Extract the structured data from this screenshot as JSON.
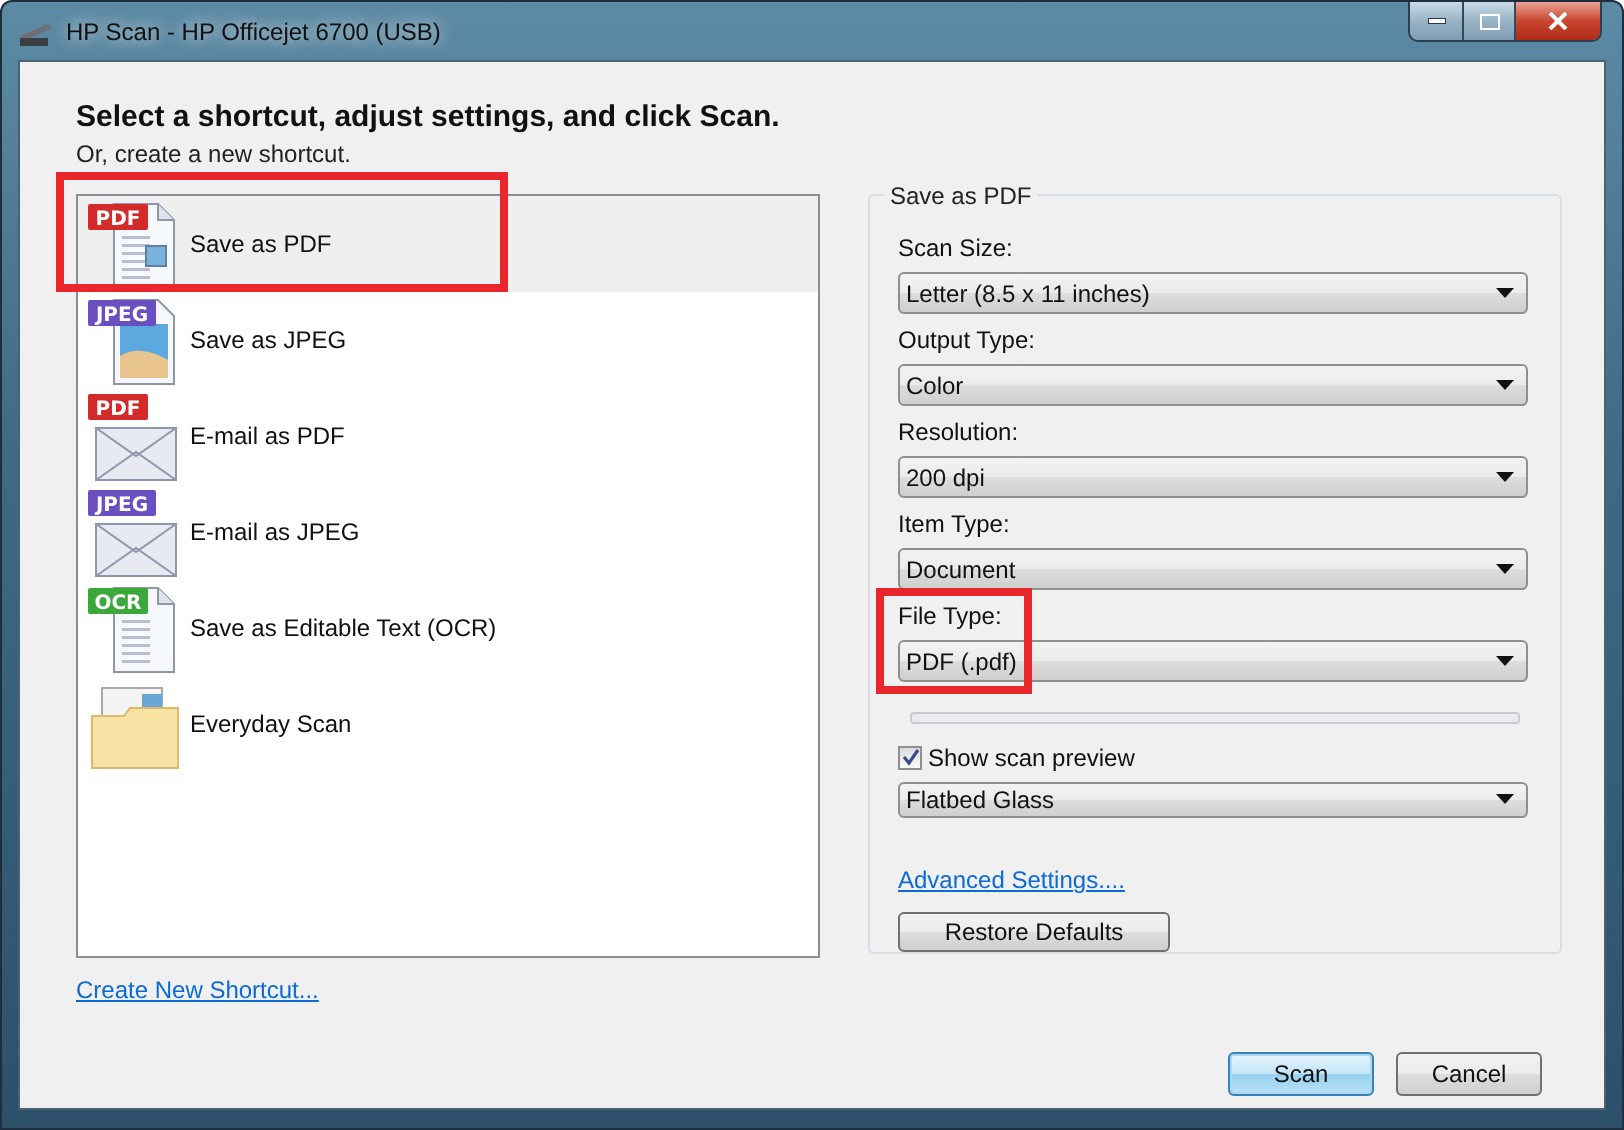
{
  "window": {
    "title": "HP Scan - HP Officejet 6700 (USB)"
  },
  "heading": "Select a shortcut, adjust settings, and click Scan.",
  "subheading": "Or, create a new shortcut.",
  "shortcuts": [
    {
      "label": "Save as PDF",
      "badge": "PDF",
      "color": "#d42a2a",
      "kind": "document",
      "selected": true,
      "highlighted": true
    },
    {
      "label": "Save as JPEG",
      "badge": "JPEG",
      "color": "#6a4fc0",
      "kind": "photo",
      "selected": false,
      "highlighted": false
    },
    {
      "label": "E-mail as PDF",
      "badge": "PDF",
      "color": "#d42a2a",
      "kind": "envelope",
      "selected": false,
      "highlighted": false
    },
    {
      "label": "E-mail as JPEG",
      "badge": "JPEG",
      "color": "#6a4fc0",
      "kind": "envelope",
      "selected": false,
      "highlighted": false
    },
    {
      "label": "Save as Editable Text (OCR)",
      "badge": "OCR",
      "color": "#3aa83a",
      "kind": "document",
      "selected": false,
      "highlighted": false
    },
    {
      "label": "Everyday Scan",
      "kind": "folder",
      "selected": false,
      "highlighted": false
    }
  ],
  "create_link": "Create New Shortcut...",
  "settings": {
    "title": "Save as PDF",
    "fields": [
      {
        "label": "Scan Size:",
        "value": "Letter (8.5 x 11 inches)",
        "highlighted": false
      },
      {
        "label": "Output Type:",
        "value": "Color",
        "highlighted": false
      },
      {
        "label": "Resolution:",
        "value": "200 dpi",
        "highlighted": false
      },
      {
        "label": "Item Type:",
        "value": "Document",
        "highlighted": false
      },
      {
        "label": "File Type:",
        "value": "PDF (.pdf)",
        "highlighted": true
      }
    ],
    "preview": {
      "label": "Show scan preview",
      "checked": true
    },
    "source": "Flatbed Glass",
    "advanced_link": "Advanced Settings....",
    "restore_button": "Restore Defaults"
  },
  "buttons": [
    {
      "label": "Scan",
      "default": true
    },
    {
      "label": "Cancel",
      "default": false
    }
  ]
}
